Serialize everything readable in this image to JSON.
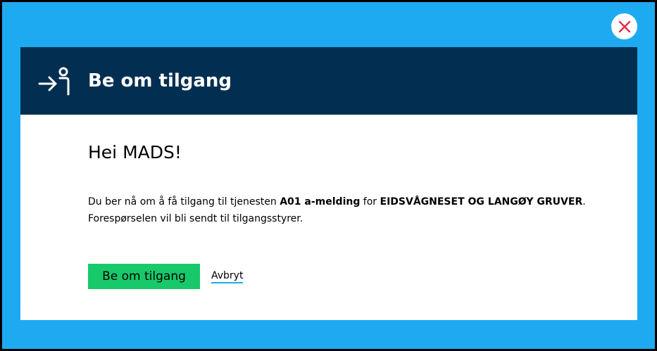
{
  "dialog": {
    "title": "Be om tilgang",
    "header_icon": "person-arrow-in-icon",
    "close_icon": "close-icon",
    "greeting": "Hei MADS!",
    "message": {
      "part1": "Du ber nå om å få tilgang til tjenesten ",
      "service": "A01 a-melding",
      "part2": " for ",
      "organization": "EIDSVÅGNESET OG LANGØY GRUVER",
      "part3": ".",
      "line2": "Forespørselen vil bli sendt til tilgangsstyrer."
    },
    "submit_label": "Be om tilgang",
    "cancel_label": "Avbryt"
  },
  "colors": {
    "backdrop": "#1eaaf1",
    "header": "#022f51",
    "primary": "#17c96b",
    "close_x": "#e02e49"
  }
}
